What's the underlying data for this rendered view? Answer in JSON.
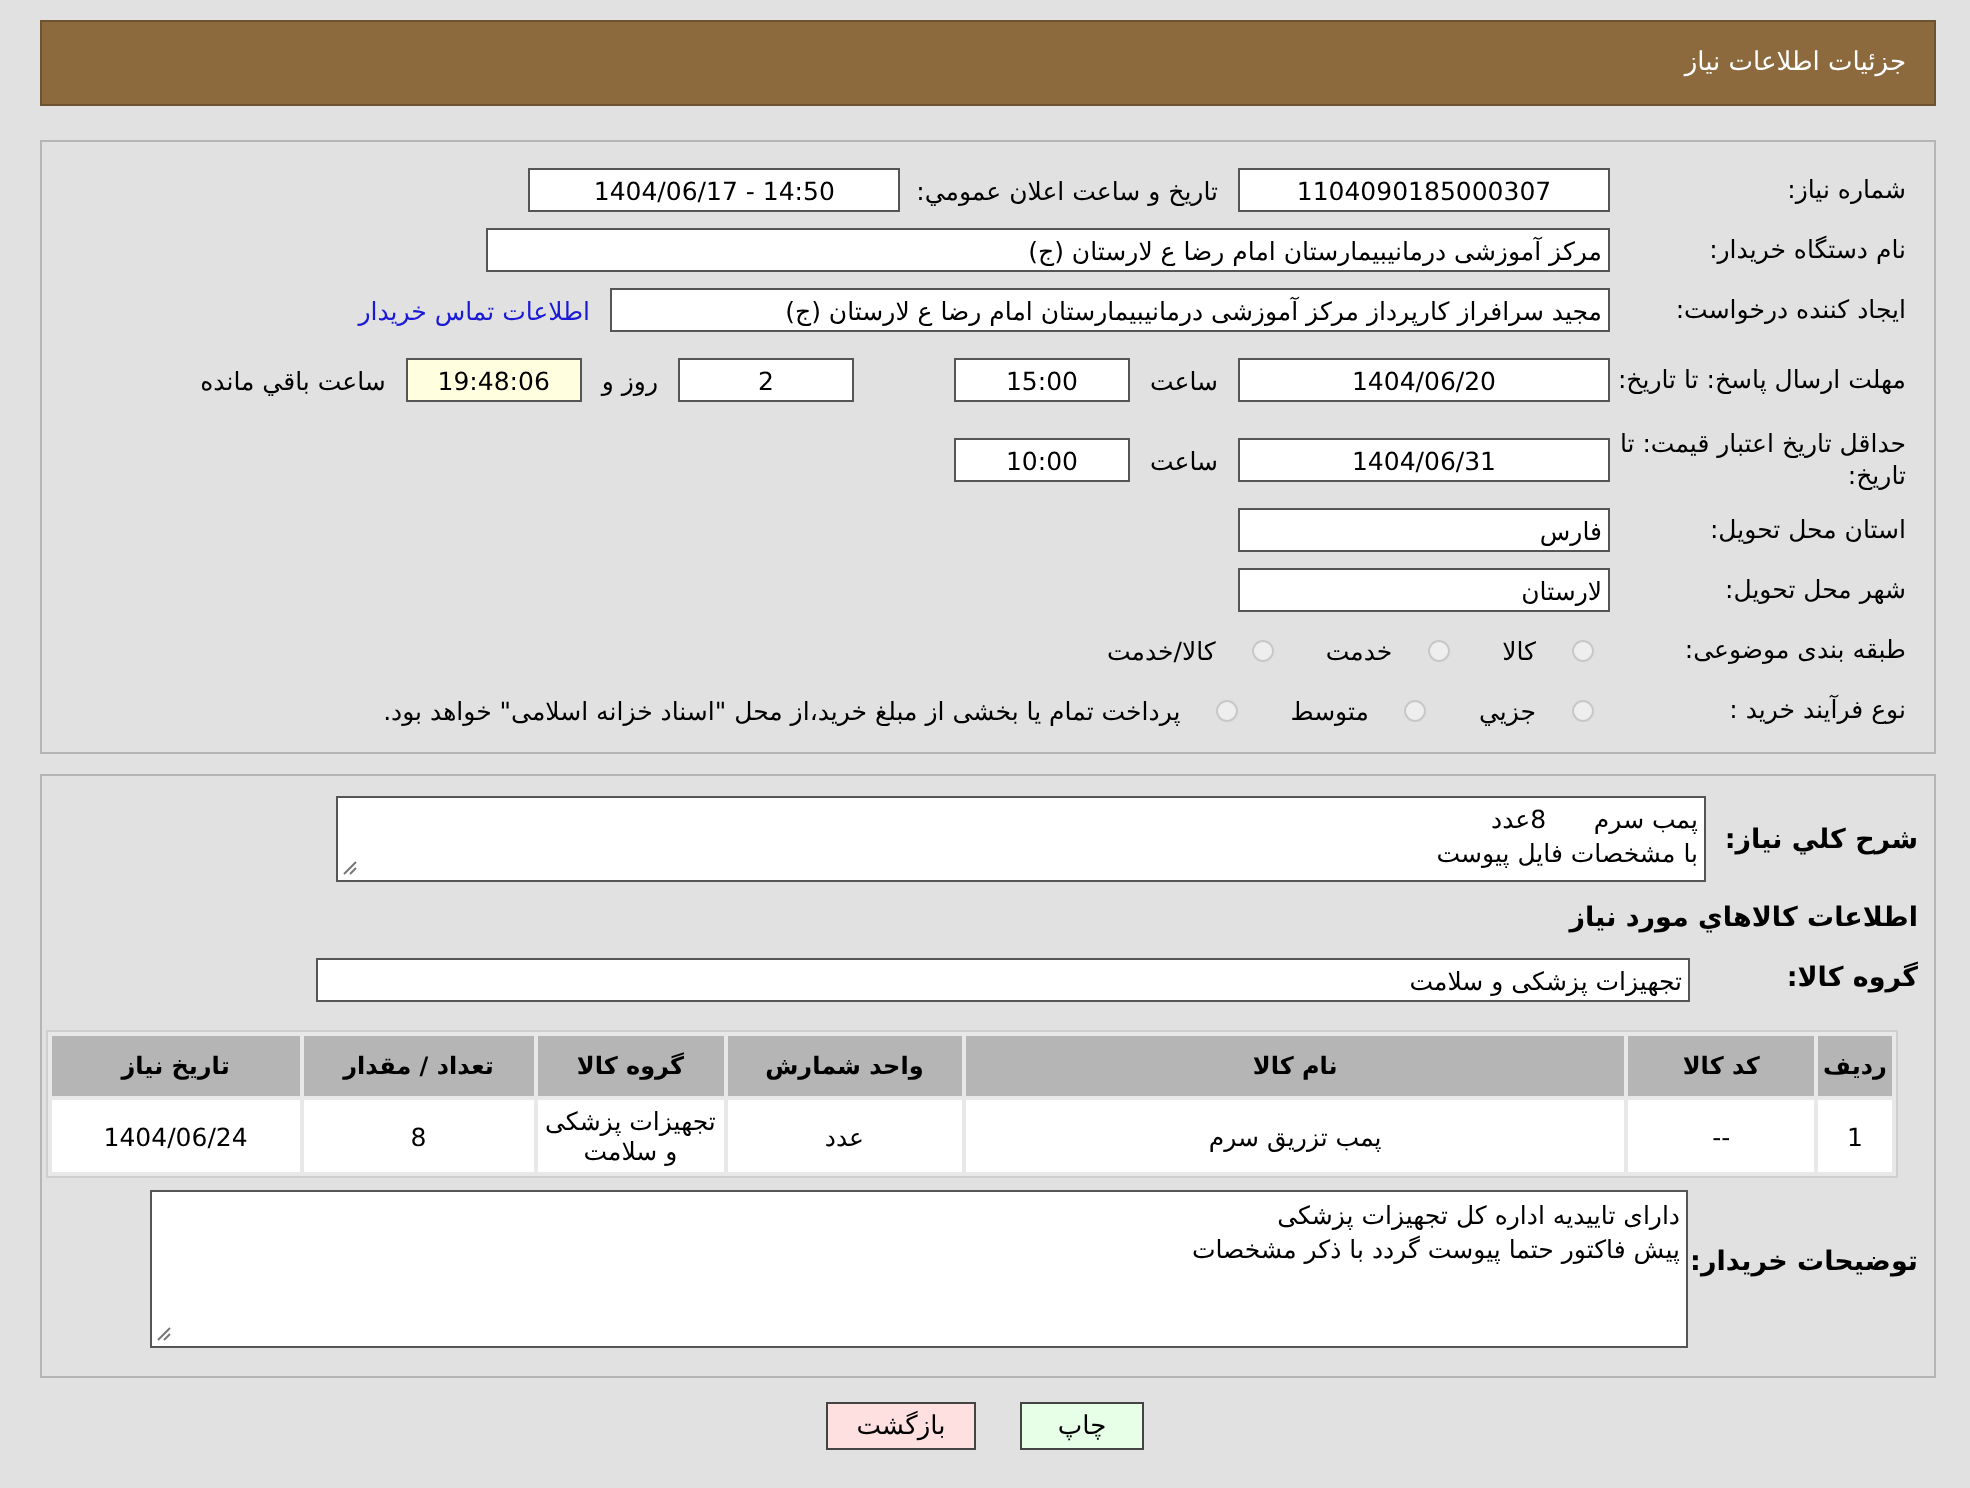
{
  "header": {
    "title": "جزئیات اطلاعات نیاز"
  },
  "fields": {
    "need_number": {
      "label": "شماره نیاز:",
      "value": "1104090185000307"
    },
    "announce": {
      "label": "تاریخ و ساعت اعلان عمومي:",
      "value": "1404/06/17 - 14:50"
    },
    "buyer": {
      "label": "نام دستگاه خریدار:",
      "value": "مرکز آموزشی درمانیبیمارستان امام رضا  ع  لارستان (ج)"
    },
    "creator": {
      "label": "ایجاد کننده درخواست:",
      "value": "مجید سرافراز کارپرداز  مرکز آموزشی درمانیبیمارستان امام رضا  ع  لارستان (ج)",
      "link": "اطلاعات تماس خریدار"
    },
    "deadline": {
      "label": "مهلت ارسال پاسخ: تا تاریخ:",
      "date": "1404/06/20",
      "time_label": "ساعت",
      "time": "15:00",
      "days": "2",
      "days_label": "روز و",
      "remaining": "19:48:06",
      "remaining_label": "ساعت باقي مانده"
    },
    "validity": {
      "label": "حداقل تاریخ اعتبار قیمت: تا تاریخ:",
      "date": "1404/06/31",
      "time_label": "ساعت",
      "time": "10:00"
    },
    "province": {
      "label": "استان محل تحویل:",
      "value": "فارس"
    },
    "city": {
      "label": "شهر محل تحویل:",
      "value": "لارستان"
    }
  },
  "category": {
    "label": "طبقه بندی موضوعی:",
    "options": [
      {
        "label": "كالا",
        "selected": false
      },
      {
        "label": "خدمت",
        "selected": false
      },
      {
        "label": "كالا/خدمت",
        "selected": false
      }
    ]
  },
  "process": {
    "label": "نوع فرآیند خرید :",
    "options": [
      {
        "label": "جزيي",
        "selected": false
      },
      {
        "label": "متوسط",
        "selected": false
      },
      {
        "label": "پرداخت تمام يا بخشی از مبلغ خرید،از محل \"اسناد خزانه اسلامی\" خواهد بود.",
        "selected": false
      }
    ]
  },
  "description": {
    "label": "شرح كلي نياز:",
    "lines": [
      "پمب سرم      8عدد",
      "با مشخصات فایل پیوست"
    ]
  },
  "goods_heading": "اطلاعات كالاهاي مورد نياز",
  "goods_group": {
    "label": "گروه کالا:",
    "value": "تجهیزات پزشکی و سلامت"
  },
  "table": {
    "columns": [
      "رديف",
      "کد کالا",
      "نام کالا",
      "واحد شمارش",
      "گروه کالا",
      "تعداد / مقدار",
      "تاریخ نیاز"
    ],
    "rows": [
      [
        "1",
        "--",
        "پمب تزریق سرم",
        "عدد",
        "تجهیزات پزشکی و سلامت",
        "8",
        "1404/06/24"
      ]
    ]
  },
  "buyer_notes": {
    "label": "توضیحات خریدار:",
    "lines": [
      "دارای تاییدیه اداره کل تجهیزات پزشکی",
      "پیش فاکتور حتما پیوست گردد با ذکر مشخصات"
    ]
  },
  "buttons": [
    {
      "label": "چاپ",
      "kind": "print"
    },
    {
      "label": "بازگشت",
      "kind": "back"
    }
  ]
}
